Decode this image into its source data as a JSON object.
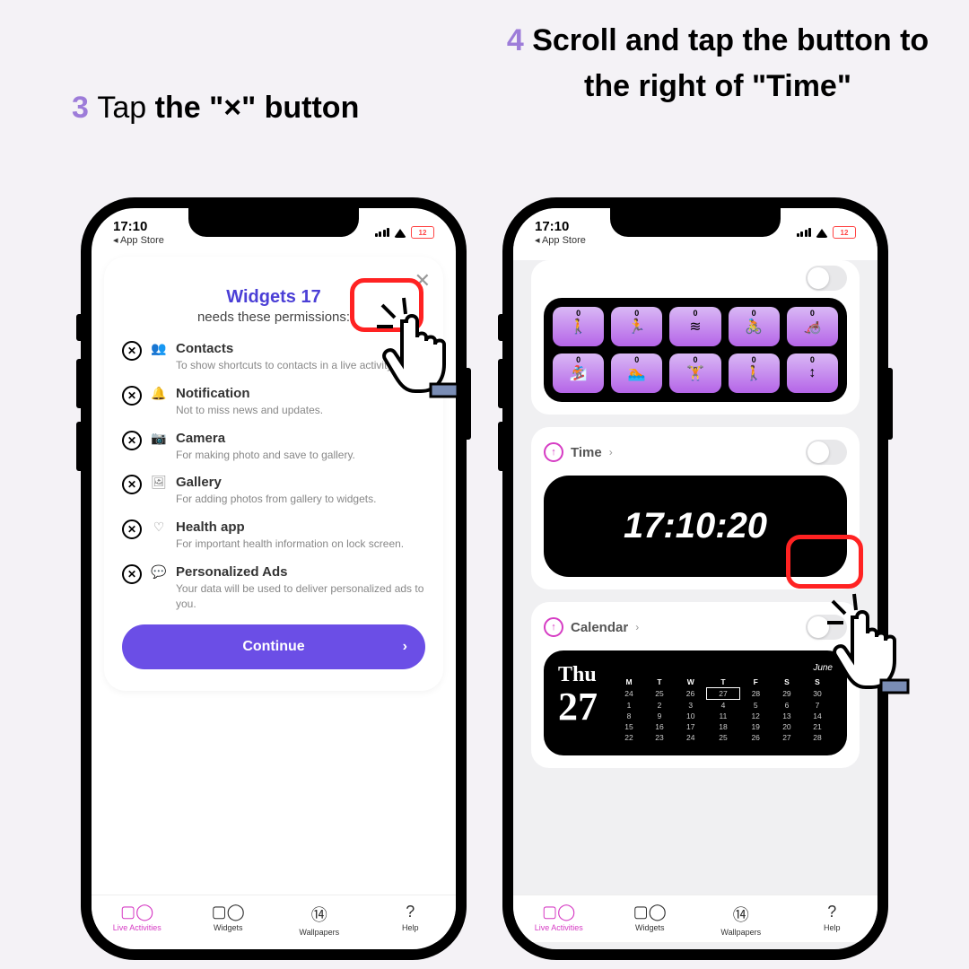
{
  "instructions": {
    "step3": {
      "num": "3",
      "pre": "Tap ",
      "bold": "the \"×\" button"
    },
    "step4": {
      "num": "4",
      "bold": "Scroll and tap the button to the right of \"Time\""
    }
  },
  "status": {
    "time": "17:10",
    "back": "◂ App Store",
    "battery": "12"
  },
  "sheet": {
    "title": "Widgets 17",
    "subtitle": "needs these permissions:",
    "perms": [
      {
        "icon": "👥",
        "title": "Contacts",
        "desc": "To show shortcuts to contacts in a live activity area."
      },
      {
        "icon": "🔔",
        "title": "Notification",
        "desc": "Not to miss news and updates."
      },
      {
        "icon": "📷",
        "title": "Camera",
        "desc": "For making photo and save to gallery."
      },
      {
        "icon": "🖼",
        "title": "Gallery",
        "desc": "For adding photos from gallery to widgets."
      },
      {
        "icon": "♡",
        "title": "Health app",
        "desc": "For important health information on lock screen."
      },
      {
        "icon": "💬",
        "title": "Personalized Ads",
        "desc": "Your data will be used to deliver personalized ads to you."
      }
    ],
    "continue": "Continue"
  },
  "tabs": [
    {
      "icon": "▢◯",
      "label": "Live Activities"
    },
    {
      "icon": "▢◯",
      "label": "Widgets"
    },
    {
      "icon": "⑭",
      "label": "Wallpapers"
    },
    {
      "icon": "?",
      "label": "Help"
    }
  ],
  "activities": {
    "zero": "0",
    "icons": [
      "🚶",
      "🏃",
      "≋",
      "🚴",
      "🦽",
      "🏂",
      "🏊",
      "🏋",
      "🚶",
      "↕"
    ]
  },
  "time_card": {
    "label": "Time",
    "clock": "17:10:20"
  },
  "cal_card": {
    "label": "Calendar",
    "dow": "Thu",
    "dom": "27",
    "month": "June",
    "days": [
      "M",
      "T",
      "W",
      "T",
      "F",
      "S",
      "S"
    ],
    "weeks": [
      [
        "24",
        "25",
        "26",
        "27",
        "28",
        "29",
        "30"
      ],
      [
        "1",
        "2",
        "3",
        "4",
        "5",
        "6",
        "7"
      ],
      [
        "8",
        "9",
        "10",
        "11",
        "12",
        "13",
        "14"
      ],
      [
        "15",
        "16",
        "17",
        "18",
        "19",
        "20",
        "21"
      ],
      [
        "22",
        "23",
        "24",
        "25",
        "26",
        "27",
        "28"
      ]
    ]
  }
}
